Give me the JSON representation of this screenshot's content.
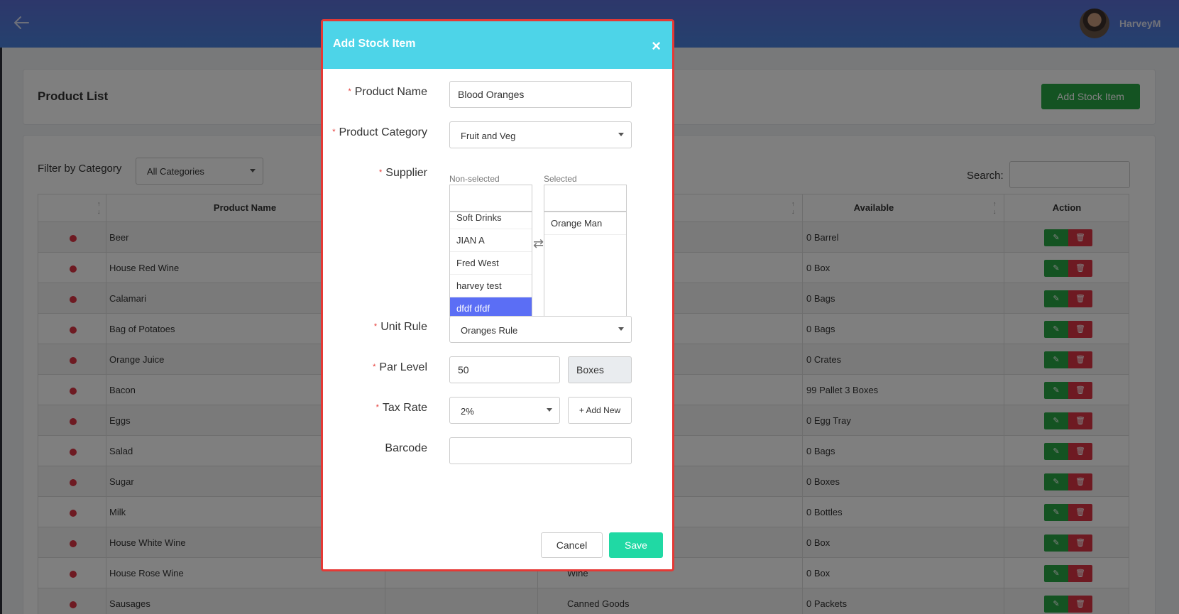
{
  "header": {
    "username": "HarveyM"
  },
  "page": {
    "title": "Product List",
    "add_button": "Add Stock Item",
    "filter_label": "Filter by Category",
    "filter_value": "All Categories",
    "search_label": "Search:"
  },
  "table": {
    "columns": [
      "Product Name",
      "gory",
      "Available",
      "Action"
    ],
    "rows": [
      {
        "name": "Beer",
        "category": "",
        "available": "0 Barrel"
      },
      {
        "name": "House Red Wine",
        "category": "",
        "available": "0 Box"
      },
      {
        "name": "Calamari",
        "category": "",
        "available": "0 Bags"
      },
      {
        "name": "Bag of Potatoes",
        "category": "",
        "available": "0 Bags"
      },
      {
        "name": "Orange Juice",
        "category": "",
        "available": "0 Crates"
      },
      {
        "name": "Bacon",
        "category": "",
        "available": "99 Pallet 3 Boxes"
      },
      {
        "name": "Eggs",
        "category": "",
        "available": "0 Egg Tray"
      },
      {
        "name": "Salad",
        "category": "",
        "available": "0 Bags"
      },
      {
        "name": "Sugar",
        "category": "",
        "available": "0 Boxes"
      },
      {
        "name": "Milk",
        "category": "",
        "available": "0 Bottles"
      },
      {
        "name": "House White Wine",
        "category": "",
        "available": "0 Box"
      },
      {
        "name": "House Rose Wine",
        "category": "Wine",
        "available": "0 Box"
      },
      {
        "name": "Sausages",
        "category": "Canned Goods",
        "available": "0 Packets"
      }
    ]
  },
  "modal": {
    "title": "Add Stock Item",
    "close": "×",
    "product_name_label": "Product Name",
    "product_name_value": "Blood Oranges",
    "category_label": "Product Category",
    "category_value": "Fruit and Veg",
    "supplier_label": "Supplier",
    "nonselected_label": "Non-selected",
    "selected_label": "Selected",
    "nonselected_items": [
      "Soft Drinks",
      "JIAN A",
      "Fred West",
      "harvey test",
      "dfdf dfdf"
    ],
    "active_item": "dfdf dfdf",
    "selected_items": [
      "Orange Man"
    ],
    "unit_rule_label": "Unit Rule",
    "unit_rule_value": "Oranges Rule",
    "par_level_label": "Par Level",
    "par_level_value": "50",
    "par_level_unit": "Boxes",
    "tax_rate_label": "Tax Rate",
    "tax_rate_value": "2%",
    "add_new": "+ Add New",
    "barcode_label": "Barcode",
    "barcode_value": "",
    "cancel": "Cancel",
    "save": "Save"
  },
  "colors": {
    "header_cyan": "#4dd4e8",
    "save_green": "#20d9a4",
    "add_green": "#28a745",
    "delete_red": "#dc3545",
    "active_item_blue": "#5b6ef5",
    "modal_border": "#e53935"
  },
  "icons": [
    "back-arrow-icon",
    "close-icon",
    "swap-icon",
    "pencil-icon",
    "trash-icon",
    "caret-down-icon",
    "sort-icon"
  ]
}
